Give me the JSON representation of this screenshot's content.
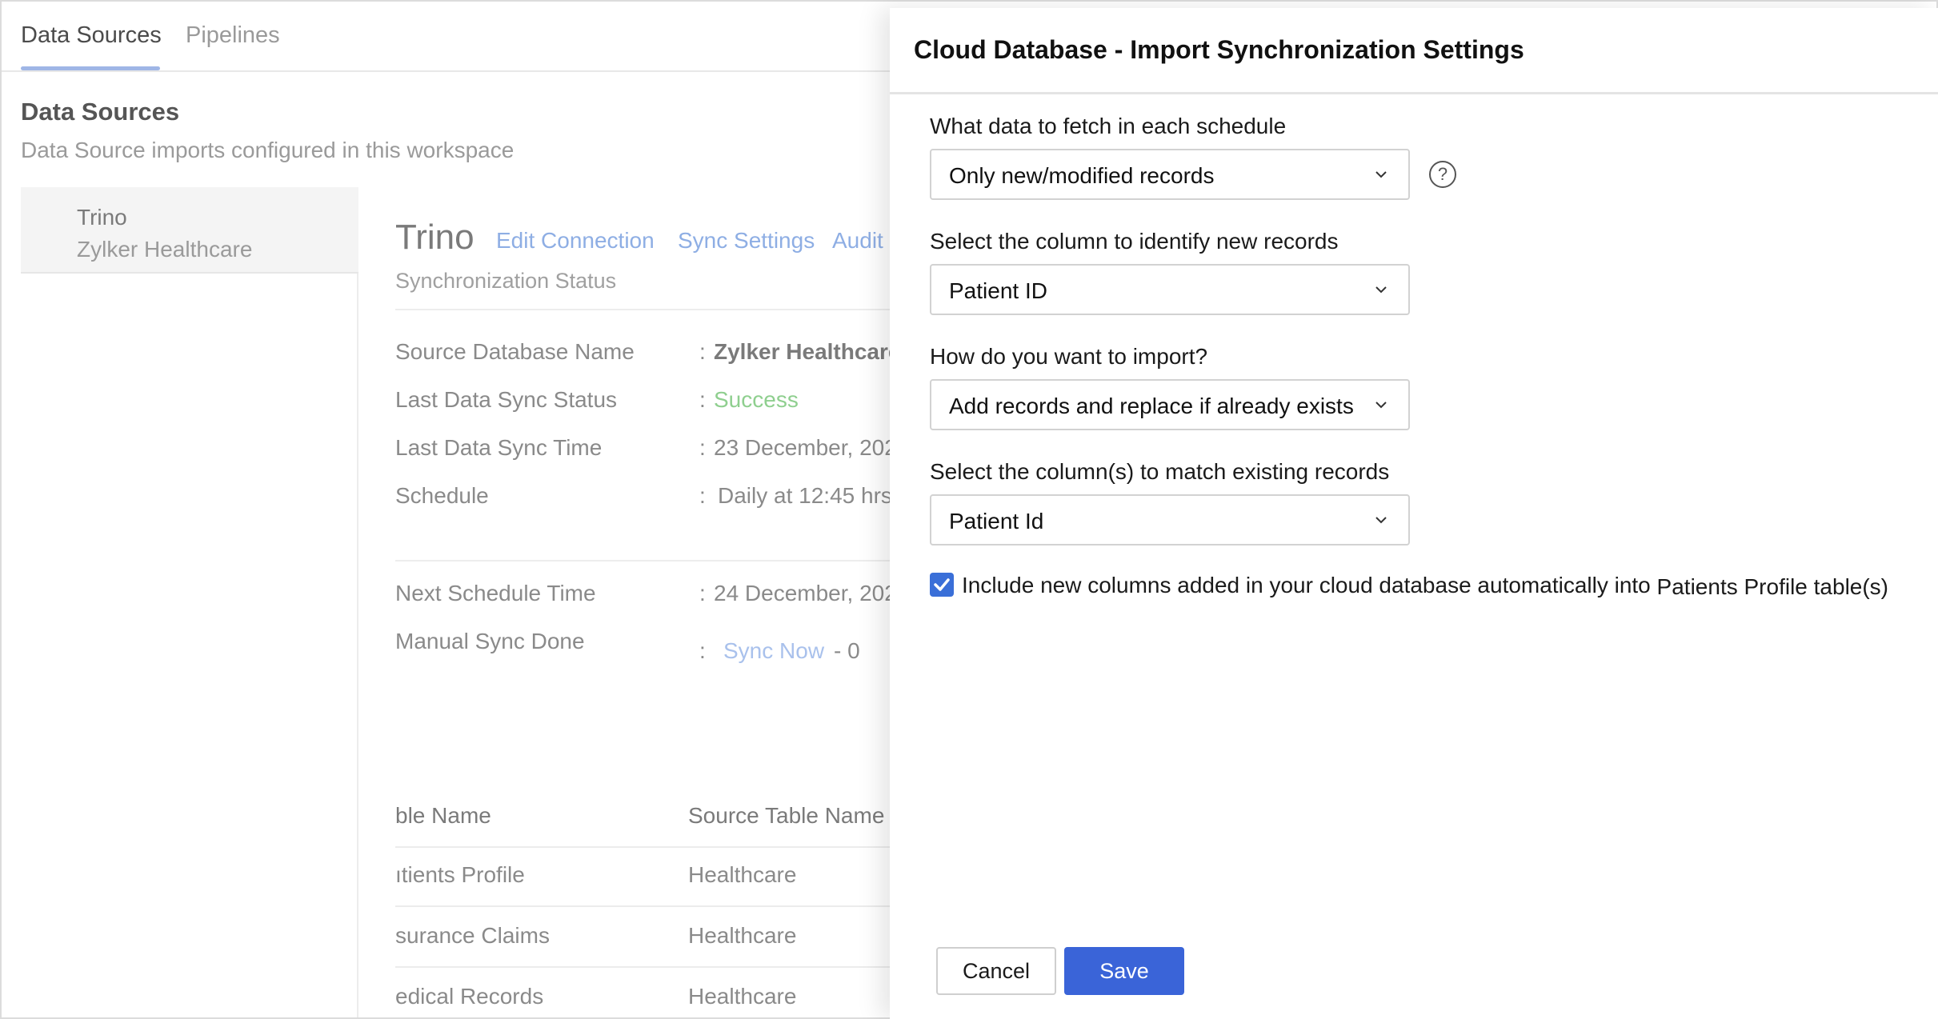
{
  "nav": {
    "tabs": [
      {
        "label": "Data Sources",
        "active": true
      },
      {
        "label": "Pipelines",
        "active": false
      }
    ]
  },
  "page": {
    "title": "Data Sources",
    "subtitle": "Data Source imports configured in this workspace"
  },
  "sidebar": {
    "items": [
      {
        "name": "Trino",
        "workspace": "Zylker Healthcare"
      }
    ]
  },
  "connection": {
    "title": "Trino",
    "links": [
      "Edit Connection",
      "Sync Settings",
      "Audit"
    ],
    "status_heading": "Synchronization Status",
    "details": [
      {
        "label": "Source Database Name",
        "value": "Zylker Healthcare"
      },
      {
        "label": "Last Data Sync Status",
        "value": "Success"
      },
      {
        "label": "Last Data Sync Time",
        "value": "23 December, 202"
      },
      {
        "label": "Schedule",
        "value": "Daily at 12:45 hrs"
      },
      {
        "label": "Next Schedule Time",
        "value": "24 December, 202"
      },
      {
        "label": "Manual Sync Done",
        "link": "Sync Now",
        "count": "- 0"
      }
    ],
    "colon": ":"
  },
  "table": {
    "headers": [
      "ble Name",
      "Source Table Name"
    ],
    "rows": [
      [
        "ıtients Profile",
        "Healthcare"
      ],
      [
        "surance Claims",
        "Healthcare"
      ],
      [
        "edical Records",
        "Healthcare"
      ]
    ]
  },
  "modal": {
    "title": "Cloud Database - Import Synchronization Settings",
    "fields": [
      {
        "label": "What data to fetch in each schedule",
        "value": "Only new/modified records"
      },
      {
        "label": "Select the column to identify new records",
        "value": "Patient ID"
      },
      {
        "label": "How do you want to import?",
        "value": "Add records and replace if already exists"
      },
      {
        "label": "Select the column(s) to match existing records",
        "value": "Patient Id"
      }
    ],
    "help_symbol": "?",
    "checkbox": {
      "checked": true,
      "label": "Include new columns added in your cloud database automatically into",
      "table": "Patients Profile table(s)"
    },
    "buttons": {
      "cancel": "Cancel",
      "save": "Save"
    },
    "colors": {
      "primary": "#3a64d8",
      "checkbox": "#3a6fd8"
    }
  }
}
